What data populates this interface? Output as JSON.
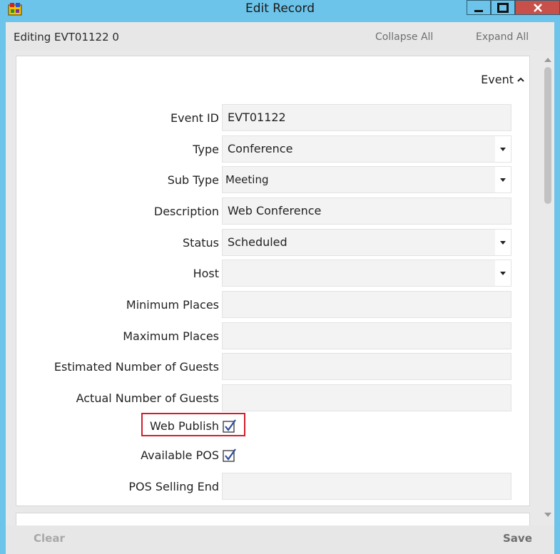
{
  "window": {
    "title": "Edit Record"
  },
  "toolbar": {
    "editing_label": "Editing EVT01122 0",
    "collapse_all": "Collapse All",
    "expand_all": "Expand All"
  },
  "section": {
    "title": "Event"
  },
  "fields": {
    "event_id": {
      "label": "Event ID",
      "value": "EVT01122"
    },
    "type": {
      "label": "Type",
      "value": "Conference"
    },
    "sub_type": {
      "label": "Sub Type",
      "value": "Meeting"
    },
    "description": {
      "label": "Description",
      "value": "Web Conference"
    },
    "status": {
      "label": "Status",
      "value": "Scheduled"
    },
    "host": {
      "label": "Host",
      "value": ""
    },
    "min_places": {
      "label": "Minimum Places",
      "value": ""
    },
    "max_places": {
      "label": "Maximum Places",
      "value": ""
    },
    "est_guests": {
      "label": "Estimated Number of Guests",
      "value": ""
    },
    "actual_guests": {
      "label": "Actual Number of Guests",
      "value": ""
    },
    "web_publish": {
      "label": "Web Publish",
      "checked": true
    },
    "available_pos": {
      "label": "Available POS",
      "checked": true
    },
    "pos_selling_end": {
      "label": "POS Selling End",
      "value": ""
    }
  },
  "footer": {
    "clear": "Clear",
    "save": "Save"
  },
  "colors": {
    "titlebar": "#6cc4ea",
    "close": "#c7504a",
    "highlight": "#d0202a",
    "disabled_text": "#a8a8a8",
    "save_text": "#6e6e6e"
  }
}
